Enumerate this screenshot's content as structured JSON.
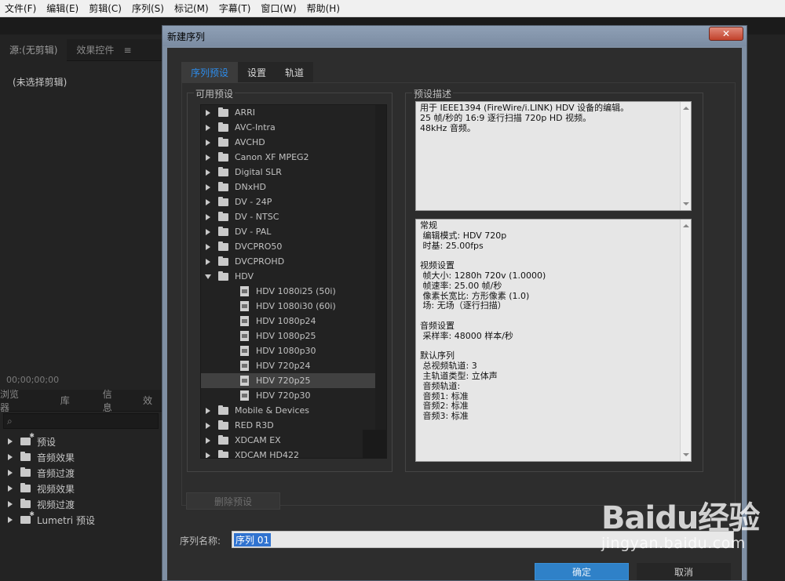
{
  "menu": [
    "文件(F)",
    "编辑(E)",
    "剪辑(C)",
    "序列(S)",
    "标记(M)",
    "字幕(T)",
    "窗口(W)",
    "帮助(H)"
  ],
  "source_panel": {
    "tabs": [
      "源:(无剪辑)",
      "效果控件"
    ],
    "menu_icon": "≡",
    "empty_text": "(未选择剪辑)",
    "timecode": "00;00;00;00"
  },
  "effects_panel": {
    "tabs": [
      "浏览器",
      "库",
      "信息",
      "效"
    ],
    "search_icon": "⌕",
    "items": [
      "预设",
      "音频效果",
      "音频过渡",
      "视频效果",
      "视频过渡",
      "Lumetri 预设"
    ]
  },
  "dialog": {
    "title": "新建序列",
    "close_label": "✕",
    "tabs": [
      "序列预设",
      "设置",
      "轨道"
    ],
    "available_presets_title": "可用预设",
    "description_title": "预设描述",
    "tree": {
      "folders_before": [
        "ARRI",
        "AVC-Intra",
        "AVCHD",
        "Canon XF MPEG2",
        "Digital SLR",
        "DNxHD",
        "DV - 24P",
        "DV - NTSC",
        "DV - PAL",
        "DVCPRO50",
        "DVCPROHD"
      ],
      "open_folder": "HDV",
      "leaves": [
        "HDV 1080i25 (50i)",
        "HDV 1080i30 (60i)",
        "HDV 1080p24",
        "HDV 1080p25",
        "HDV 1080p30",
        "HDV 720p24",
        "HDV 720p25",
        "HDV 720p30"
      ],
      "selected_leaf": "HDV 720p25",
      "folders_after": [
        "Mobile & Devices",
        "RED R3D",
        "XDCAM EX",
        "XDCAM HD422"
      ]
    },
    "description": [
      "用于 IEEE1394 (FireWire/i.LINK) HDV 设备的编辑。",
      "25 帧/秒的 16:9 逐行扫描 720p HD 视频。",
      "48kHz 音频。"
    ],
    "details": [
      "常规",
      " 编辑模式: HDV 720p",
      " 时基: 25.00fps",
      "",
      "视频设置",
      " 帧大小: 1280h 720v (1.0000)",
      " 帧速率: 25.00 帧/秒",
      " 像素长宽比: 方形像素 (1.0)",
      " 场: 无场（逐行扫描）",
      "",
      "音频设置",
      " 采样率: 48000 样本/秒",
      "",
      "默认序列",
      " 总视频轨道: 3",
      " 主轨道类型: 立体声",
      " 音频轨道:",
      " 音频1: 标准",
      " 音频2: 标准",
      " 音频3: 标准"
    ],
    "delete_preset_label": "删除预设",
    "sequence_name_label": "序列名称:",
    "sequence_name_value": "序列 01",
    "ok_label": "确定",
    "cancel_label": "取消"
  },
  "watermark": {
    "logo": "Baidu经验",
    "url": "jingyan.baidu.com"
  }
}
